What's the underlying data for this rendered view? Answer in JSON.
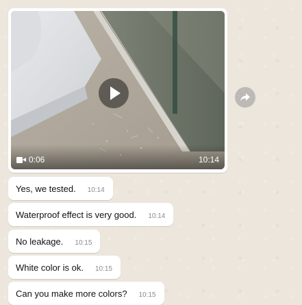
{
  "video": {
    "duration": "0:06",
    "time": "10:14",
    "play_icon": "play-icon",
    "camera_icon": "video-camera-icon"
  },
  "forward": {
    "icon": "forward-icon"
  },
  "messages": [
    {
      "text": "Yes, we tested.",
      "time": "10:14"
    },
    {
      "text": "Waterproof effect is very good.",
      "time": "10:14"
    },
    {
      "text": "No leakage.",
      "time": "10:15"
    },
    {
      "text": "White color is ok.",
      "time": "10:15"
    },
    {
      "text": "Can you make more colors?",
      "time": "10:15"
    }
  ],
  "colors": {
    "chat_background": "#ece6dd",
    "bubble": "#ffffff",
    "timestamp": "#8a8a8a"
  }
}
